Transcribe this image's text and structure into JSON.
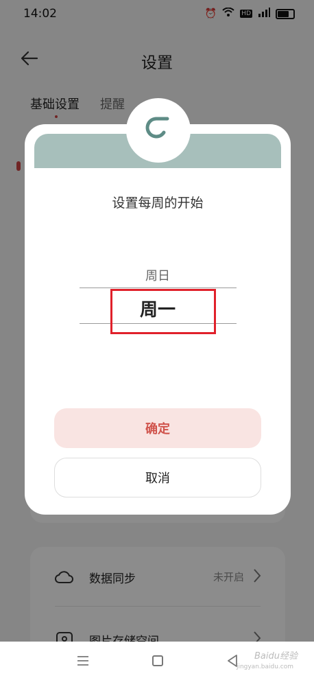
{
  "status_bar": {
    "time": "14:02",
    "icons": [
      "alarm-icon",
      "wifi-icon",
      "hd-badge",
      "signal-icon",
      "battery-icon"
    ],
    "hd": "HD"
  },
  "header": {
    "title": "设置"
  },
  "tabs": [
    {
      "label": "基础设置"
    },
    {
      "label": "提醒"
    }
  ],
  "background_list": {
    "rows": [
      {
        "icon": "cloud-icon",
        "label": "数据同步",
        "value": "未开启"
      },
      {
        "icon": "image-icon",
        "label": "图片存储空间",
        "value": ""
      }
    ]
  },
  "dialog": {
    "title": "设置每周的开始",
    "picker": {
      "previous": "周日",
      "selected": "周一"
    },
    "confirm_label": "确定",
    "cancel_label": "取消",
    "colors": {
      "banner": "#a7bfbb",
      "confirm_bg": "#f9e4e2",
      "confirm_text": "#d0534c",
      "highlight": "#e0202a",
      "logo": "#5e8c86"
    }
  },
  "nav_bar": {
    "watermark": "Baidu经验",
    "watermark_sub": "jingyan.baidu.com"
  }
}
